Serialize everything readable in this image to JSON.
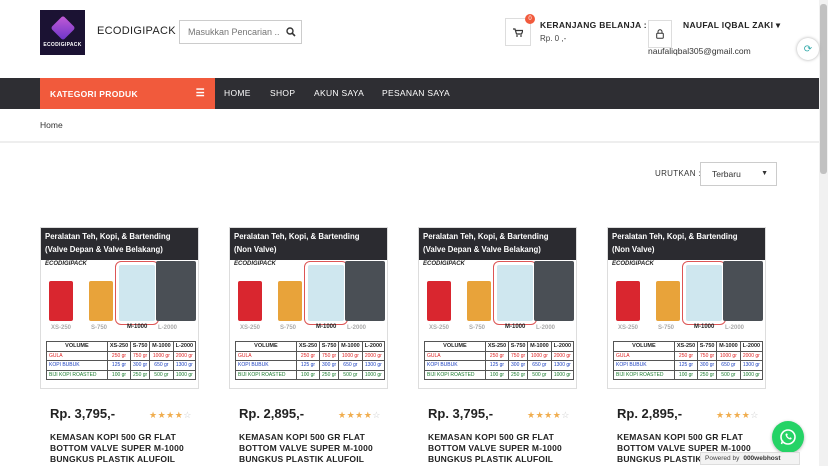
{
  "header": {
    "logo_text": "ECODIGIPACK",
    "brand": "ECODIGIPACK",
    "search_placeholder": "Masukkan Pencarian ..",
    "cart_count": "0",
    "cart_title": "KERANJANG BELANJA :",
    "cart_total": "Rp. 0 ,-",
    "user_name": "NAUFAL IQBAL ZAKI ▾",
    "user_email": "naufaliqbal305@gmail.com"
  },
  "nav": {
    "category": "KATEGORI PRODUK",
    "links": [
      "HOME",
      "SHOP",
      "AKUN SAYA",
      "PESANAN SAYA"
    ]
  },
  "breadcrumb": "Home",
  "sort": {
    "label": "URUTKAN :",
    "value": "Terbaru"
  },
  "products": [
    {
      "band1": "Peralatan Teh, Kopi, & Bartending",
      "band2": "(Valve Depan & Valve Belakang)",
      "price": "Rp. 3,795,-",
      "rating": 4,
      "title": "KEMASAN KOPI 500 GR FLAT BOTTOM VALVE SUPER M-1000 BUNGKUS PLASTIK ALUFOIL"
    },
    {
      "band1": "Peralatan Teh, Kopi, & Bartending",
      "band2": "(Non Valve)",
      "price": "Rp. 2,895,-",
      "rating": 4,
      "title": "KEMASAN KOPI 500 GR FLAT BOTTOM VALVE SUPER M-1000 BUNGKUS PLASTIK ALUFOIL"
    },
    {
      "band1": "Peralatan Teh, Kopi, & Bartending",
      "band2": "(Valve Depan & Valve Belakang)",
      "price": "Rp. 3,795,-",
      "rating": 4,
      "title": "KEMASAN KOPI 500 GR FLAT BOTTOM VALVE SUPER M-1000 BUNGKUS PLASTIK ALUFOIL"
    },
    {
      "band1": "Peralatan Teh, Kopi, & Bartending",
      "band2": "(Non Valve)",
      "price": "Rp. 2,895,-",
      "rating": 4,
      "title": "KEMASAN KOPI 500 GR FLAT BOTTOM VALVE SUPER M-1000 BUNGKUS PLASTIK ALUFOIL"
    }
  ],
  "card_image": {
    "brand": "ECODIGIPACK",
    "bag_labels": [
      "XS-250",
      "S-750",
      "M-1000",
      "L-2000"
    ],
    "bag_colors": [
      "#d9262f",
      "#e8a33a",
      "#cfe7ef",
      "#4a4f55"
    ],
    "table_header": [
      "VOLUME",
      "XS-250",
      "S-750",
      "M-1000",
      "L-2000"
    ],
    "rows": [
      [
        "GULA",
        "250 gr",
        "750 gr",
        "1000 gr",
        "2000 gr"
      ],
      [
        "KOPI BUBUK",
        "125 gr",
        "300 gr",
        "650 gr",
        "1300 gr"
      ],
      [
        "BIJI KOPI ROASTED",
        "100 gr",
        "250 gr",
        "500 gr",
        "1000 gr"
      ]
    ]
  },
  "whatsapp_icon": "whatsapp-icon",
  "hosting_badge": {
    "label": "Powered by",
    "name": "000webhost"
  }
}
